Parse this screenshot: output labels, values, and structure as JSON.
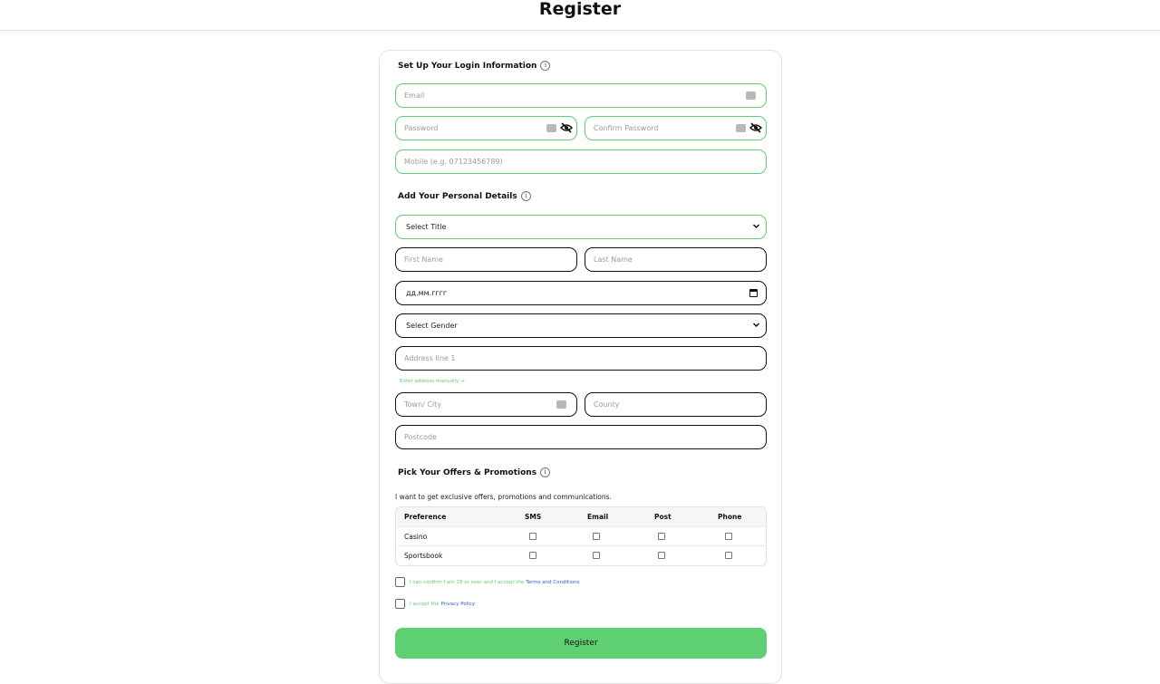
{
  "header": {
    "title": "Register"
  },
  "login": {
    "title": "Set Up Your Login Information",
    "email_placeholder": "Email",
    "password_placeholder": "Password",
    "confirm_placeholder": "Confirm Password",
    "mobile_placeholder": "Mobile (e.g. 07123456789)"
  },
  "personal": {
    "title": "Add Your Personal Details",
    "title_select": "Select Title",
    "first_name_placeholder": "First Name",
    "last_name_placeholder": "Last Name",
    "dob_value": "дд.мм.гггг",
    "gender_select": "Select Gender",
    "address_placeholder": "Address line 1",
    "manual_link": "Enter address manually →",
    "town_placeholder": "Town/ City",
    "county_placeholder": "County",
    "postcode_placeholder": "Postcode"
  },
  "offers": {
    "title": "Pick Your Offers & Promotions",
    "description": "I want to get exclusive offers, promotions and communications.",
    "columns": [
      "Preference",
      "SMS",
      "Email",
      "Post",
      "Phone"
    ],
    "rows": [
      "Casino",
      "Sportsbook"
    ]
  },
  "agreements": {
    "terms_text": "I can confirm I am 18 or over and I accept the",
    "terms_link": "Terms and Conditions",
    "privacy_text": "I accept the",
    "privacy_link": "Privacy Policy"
  },
  "submit_label": "Register",
  "colors": {
    "accent": "#5fcf73",
    "link": "#2d5bd6"
  }
}
